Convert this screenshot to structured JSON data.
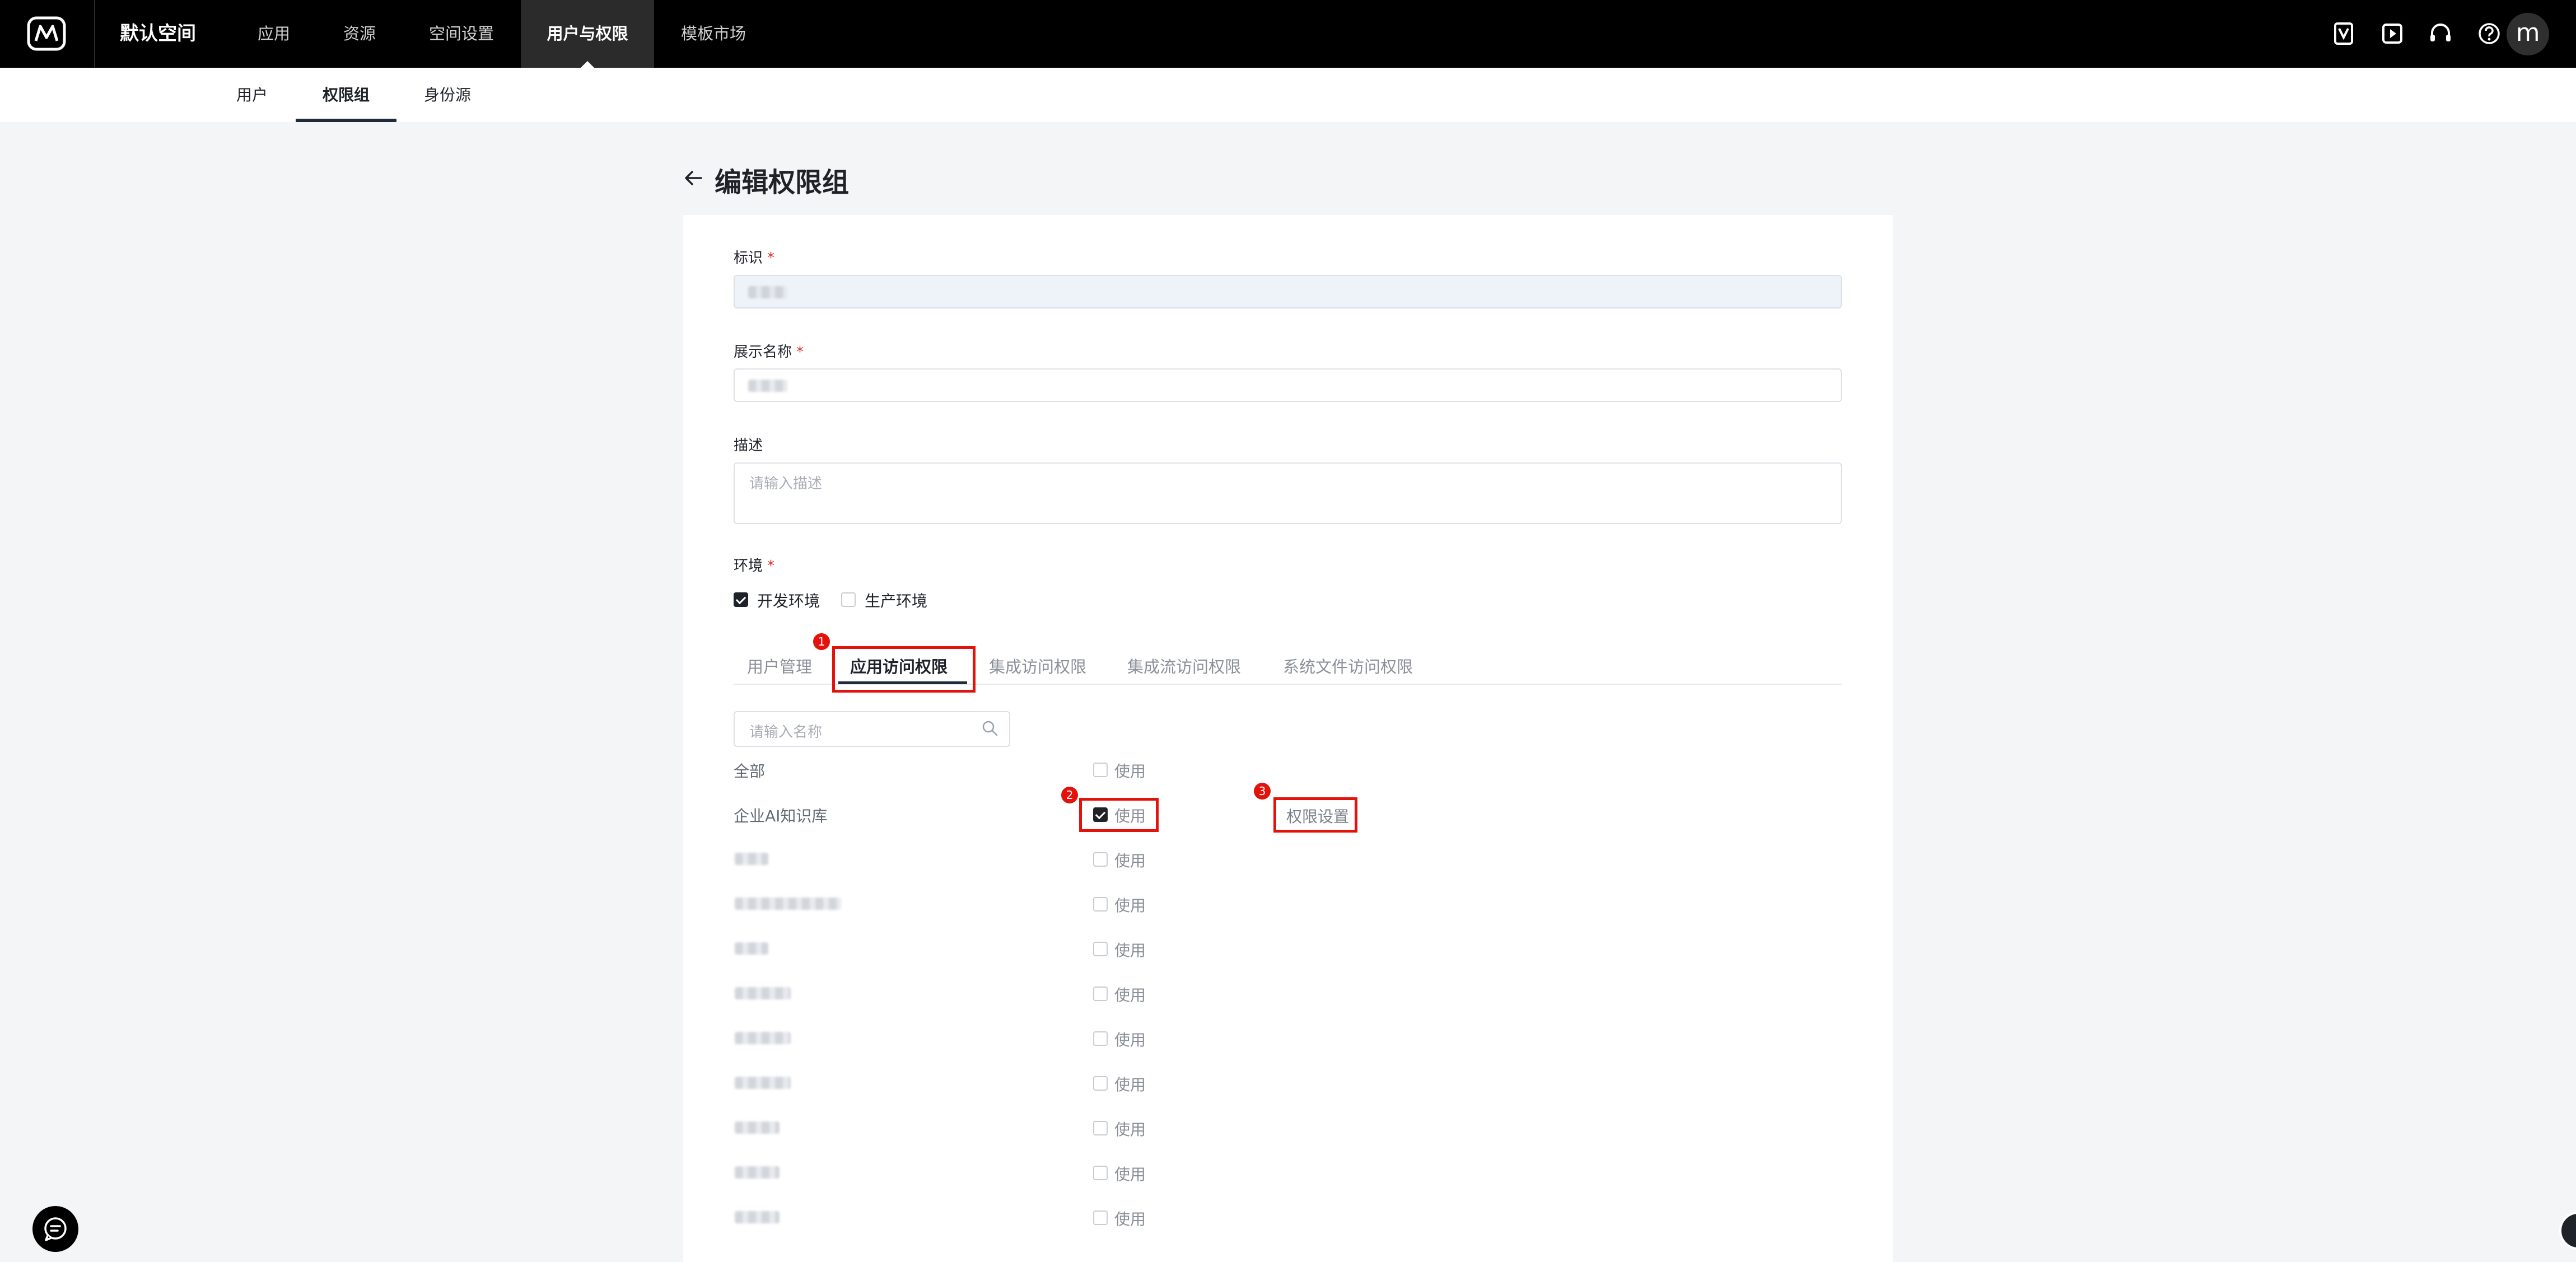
{
  "topbar": {
    "workspace": "默认空间",
    "nav": [
      {
        "label": "应用"
      },
      {
        "label": "资源"
      },
      {
        "label": "空间设置"
      },
      {
        "label": "用户与权限"
      },
      {
        "label": "模板市场"
      }
    ],
    "icons": [
      "v-badge-icon",
      "play-icon",
      "headset-icon",
      "help-icon"
    ],
    "avatar": "m"
  },
  "subtabs": [
    "用户",
    "权限组",
    "身份源"
  ],
  "page": {
    "title": "编辑权限组",
    "fields": {
      "id_label": "标识",
      "display_name_label": "展示名称",
      "description_label": "描述",
      "description_placeholder": "请输入描述",
      "env_label": "环境",
      "env_options": [
        {
          "label": "开发环境",
          "checked": true
        },
        {
          "label": "生产环境",
          "checked": false
        }
      ]
    },
    "tabs": [
      "用户管理",
      "应用访问权限",
      "集成访问权限",
      "集成流访问权限",
      "系统文件访问权限"
    ],
    "search_placeholder": "请输入名称",
    "use_label": "使用",
    "permission_settings": "权限设置",
    "rows": [
      {
        "name": "全部",
        "checked": false
      },
      {
        "name": "企业AI知识库",
        "checked": true
      }
    ],
    "annotations": [
      "1",
      "2",
      "3"
    ]
  },
  "colors": {
    "topbar": "#000000",
    "accent": "#1f2a3b",
    "annotation": "#e3120b"
  }
}
